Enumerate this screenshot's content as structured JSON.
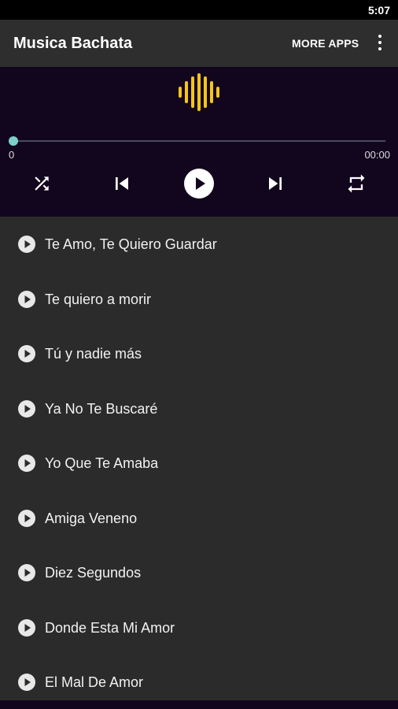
{
  "status_bar": {
    "time": "5:07"
  },
  "app_bar": {
    "title": "Musica Bachata",
    "more_apps_label": "MORE APPS",
    "overflow_icon": "more-vert-icon"
  },
  "player": {
    "visualizer_icon": "sound-wave-icon",
    "visualizer_color": "#f5c518",
    "progress": 0,
    "position_label": "0",
    "duration_label": "00:00",
    "controls": [
      {
        "name": "shuffle",
        "icon": "shuffle-icon"
      },
      {
        "name": "previous",
        "icon": "skip-previous-icon"
      },
      {
        "name": "play",
        "icon": "play-circle-icon"
      },
      {
        "name": "next",
        "icon": "skip-next-icon"
      },
      {
        "name": "repeat",
        "icon": "repeat-icon"
      }
    ]
  },
  "playlist": {
    "items": [
      {
        "title": "Te Amo, Te Quiero Guardar"
      },
      {
        "title": "Te quiero a morir"
      },
      {
        "title": "Tú y nadie más"
      },
      {
        "title": "Ya No Te Buscaré"
      },
      {
        "title": "Yo Que Te Amaba"
      },
      {
        "title": "Amiga Veneno"
      },
      {
        "title": "Diez Segundos"
      },
      {
        "title": "Donde Esta Mi Amor"
      },
      {
        "title": "El Mal De Amor"
      }
    ]
  },
  "colors": {
    "app_bar": "#2e2e2e",
    "player_bg": "#12061f",
    "list_bg": "#2b2b2b",
    "accent": "#7fd0c8"
  }
}
